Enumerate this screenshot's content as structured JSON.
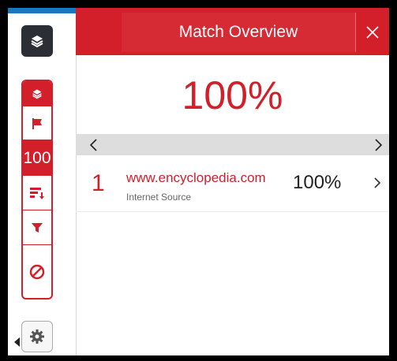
{
  "header": {
    "title": "Match Overview",
    "close_icon": "close-icon"
  },
  "overall": {
    "percent": "100%"
  },
  "nav": {
    "prev_icon": "chevron-left-icon",
    "next_icon": "chevron-right-icon"
  },
  "sidebar": {
    "top_button_icon": "layers-icon",
    "tools": [
      {
        "name": "layers-small-icon"
      },
      {
        "name": "flag-icon"
      },
      {
        "name": "match-count",
        "label": "100"
      },
      {
        "name": "sort-icon"
      },
      {
        "name": "filter-icon"
      },
      {
        "name": "block-icon"
      }
    ],
    "settings_icon": "gear-icon"
  },
  "matches": [
    {
      "number": "1",
      "source": "www.encyclopedia.com",
      "type": "Internet Source",
      "percent": "100%"
    }
  ],
  "colors": {
    "accent": "#d21f2a",
    "dark": "#2c2e36",
    "rail_top": "#1a78c2"
  }
}
